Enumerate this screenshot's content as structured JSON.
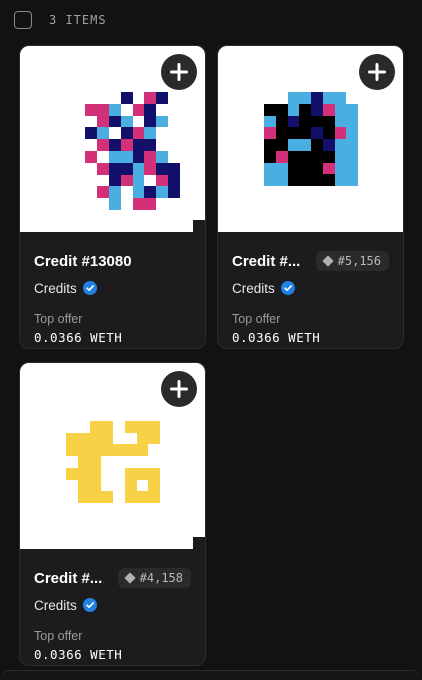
{
  "header": {
    "count_label": "3 ITEMS"
  },
  "colors": {
    "pink": "#d2317a",
    "navy": "#12106b",
    "sky": "#4aaee0",
    "black": "#000000",
    "yellow": "#f7d247"
  },
  "items": [
    {
      "title": "Credit #13080",
      "collection": "Credits",
      "offer_label": "Top offer",
      "offer_value": "0.0366 WETH",
      "rank": ""
    },
    {
      "title": "Credit #...",
      "collection": "Credits",
      "offer_label": "Top offer",
      "offer_value": "0.0366 WETH",
      "rank": "#5,156"
    },
    {
      "title": "Credit #...",
      "collection": "Credits",
      "offer_label": "Top offer",
      "offer_value": "0.0366 WETH",
      "rank": "#4,158"
    }
  ],
  "icons": {
    "add": "plus-icon",
    "verified": "verified-badge-icon",
    "rank": "diamond-icon",
    "select": "checkbox-icon"
  }
}
